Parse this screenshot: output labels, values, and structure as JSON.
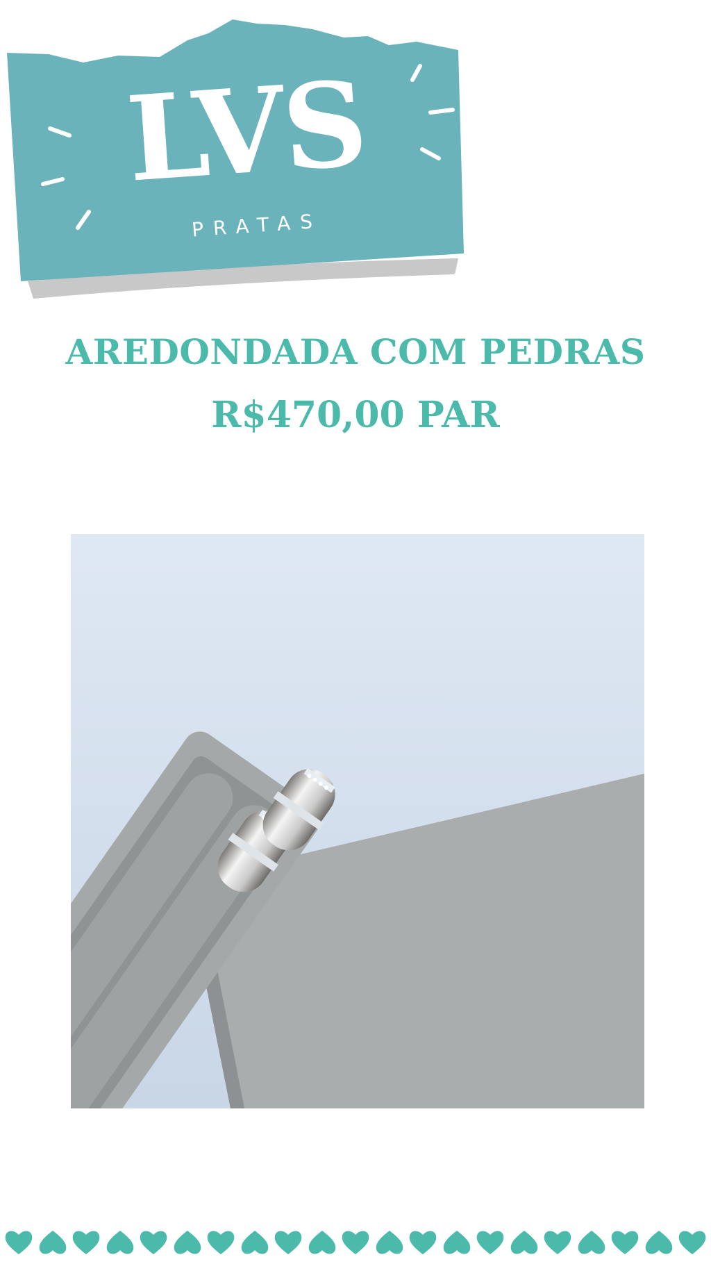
{
  "logo": {
    "brand": "LVS",
    "subtitle": "PRATAS",
    "badge_color": "#6bb3bb"
  },
  "product": {
    "title": "AREDONDADA COM PEDRAS",
    "price": "R$470,00 PAR",
    "accent_color": "#4bbaaa"
  },
  "photo": {
    "icon": "product-photo-rings-in-gray-velvet-box"
  },
  "footer": {
    "icon": "heart-icon",
    "heart_color": "#4bbaaa",
    "heart_count": 21
  }
}
